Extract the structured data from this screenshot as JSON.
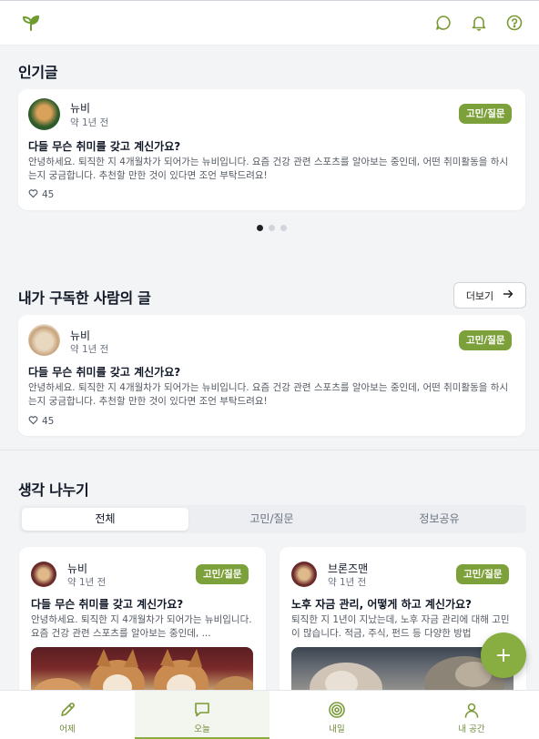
{
  "colors": {
    "accent": "#88ad40",
    "badge": "#7da13a"
  },
  "header": {
    "icons": [
      "sprout-icon",
      "chat-icon",
      "bell-icon",
      "help-icon"
    ]
  },
  "popular": {
    "title": "인기글",
    "post": {
      "author": "뉴비",
      "time": "약 1년 전",
      "badge": "고민/질문",
      "title": "다들 무슨 취미를 갖고 계신가요?",
      "body": "안녕하세요. 퇴직한 지 4개월차가 되어가는 뉴비입니다. 요즘 건강 관련 스포츠를 알아보는 중인데, 어떤 취미활동을 하시는지 궁금합니다. 추천할 만한 것이 있다면 조언 부탁드려요!",
      "likes": "45"
    }
  },
  "subscribed": {
    "title": "내가 구독한 사람의 글",
    "more": "더보기",
    "post": {
      "author": "뉴비",
      "time": "약 1년 전",
      "badge": "고민/질문",
      "title": "다들 무슨 취미를 갖고 계신가요?",
      "body": "안녕하세요. 퇴직한 지 4개월차가 되어가는 뉴비입니다. 요즘 건강 관련 스포츠를 알아보는 중인데, 어떤 취미활동을 하시는지 궁금합니다. 추천할 만한 것이 있다면 조언 부탁드려요!",
      "likes": "45"
    }
  },
  "share": {
    "title": "생각 나누기",
    "tabs": [
      "전체",
      "고민/질문",
      "정보공유"
    ],
    "cards": [
      {
        "author": "뉴비",
        "time": "약 1년 전",
        "badge": "고민/질문",
        "title": "다들 무슨 취미를 갖고 계신가요?",
        "body": "안녕하세요. 퇴직한 지 4개월차가 되어가는 뉴비입니다. 요즘 건강 관련 스포츠를 알아보는 중인데, ..."
      },
      {
        "author": "브론즈맨",
        "time": "약 1년 전",
        "badge": "고민/질문",
        "title": "노후 자금 관리, 어떻게 하고 계신가요?",
        "body": "퇴직한 지 1년이 지났는데, 노후 자금 관리에 대해 고민이 많습니다. 적금, 주식, 펀드 등 다양한 방법"
      }
    ]
  },
  "fab": "+",
  "nav": [
    {
      "label": "어제",
      "icon": "pencil-icon"
    },
    {
      "label": "오늘",
      "icon": "message-icon"
    },
    {
      "label": "내일",
      "icon": "target-icon"
    },
    {
      "label": "내 공간",
      "icon": "person-icon"
    }
  ]
}
